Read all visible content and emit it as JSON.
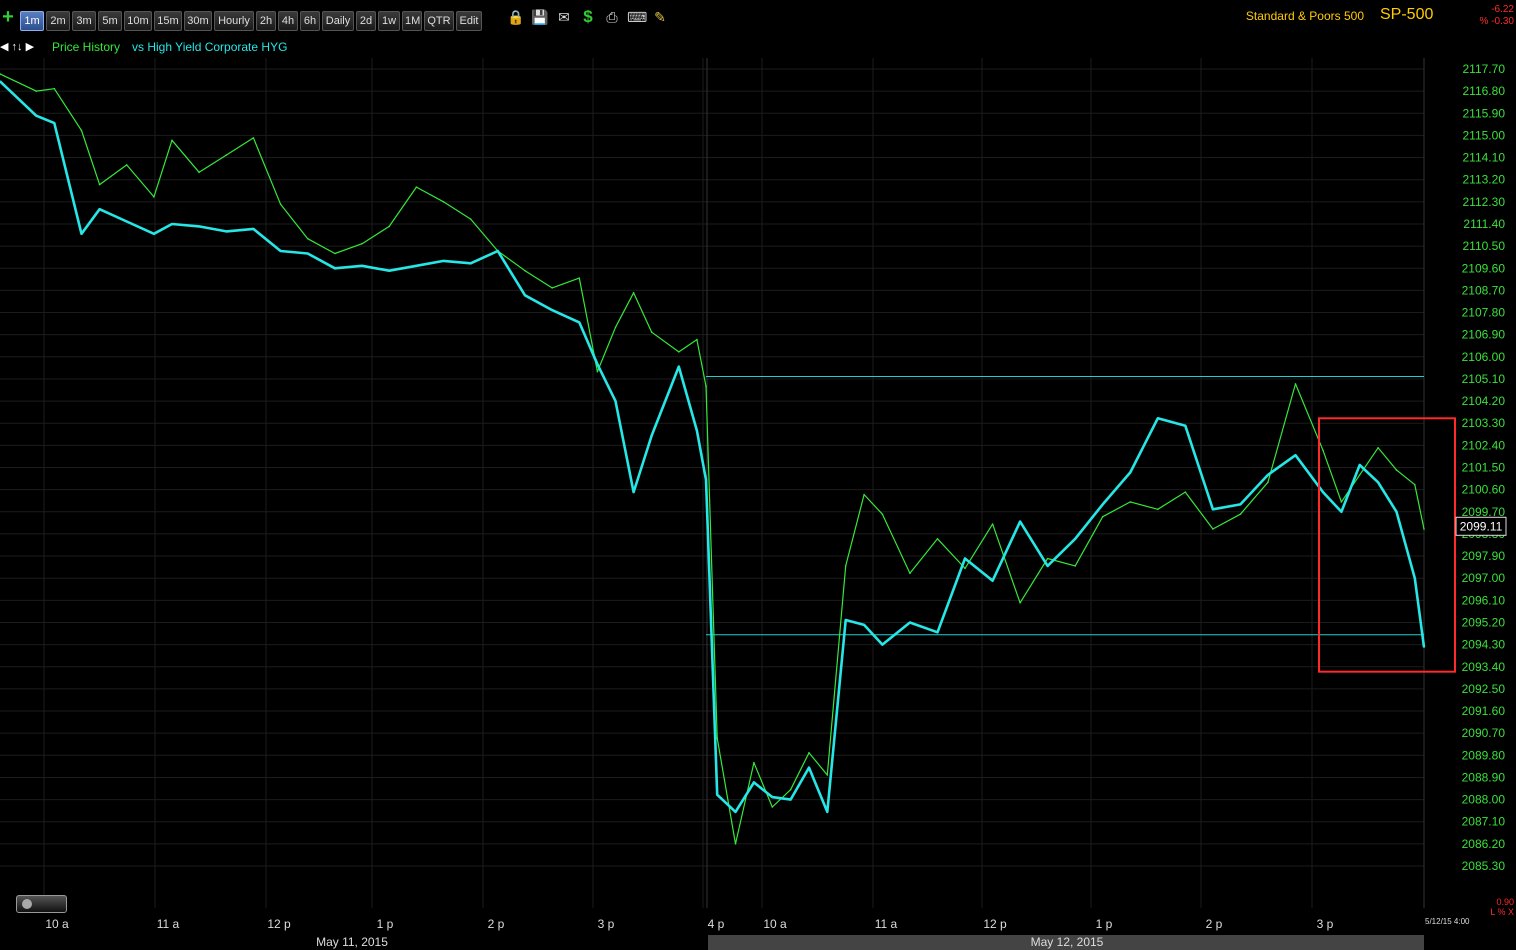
{
  "toolbar": {
    "intervals": [
      "1m",
      "2m",
      "3m",
      "5m",
      "10m",
      "15m",
      "30m",
      "Hourly",
      "2h",
      "4h",
      "6h",
      "Daily",
      "2d",
      "1w",
      "1M",
      "QTR",
      "Edit"
    ],
    "active_interval": "1m",
    "icons": [
      "lock-icon",
      "save-icon",
      "email-icon",
      "dollar-icon",
      "print-icon",
      "keyboard-icon",
      "pencil-icon"
    ]
  },
  "symbol": {
    "name": "Standard & Poors 500",
    "code": "SP-500",
    "change": "-6.22",
    "change_pct": "% -0.30"
  },
  "legend": {
    "nav": "◀ ↑↓ ▶",
    "series1": "Price History",
    "series2": "vs High Yield Corporate HYG"
  },
  "axis_controls": {
    "value": "0.90",
    "label": "L % X"
  },
  "date_stamp": "5/12/15 4:00",
  "colors": {
    "price": "#34e83a",
    "hyg": "#26e6e6",
    "axis_text": "#39e03a",
    "annotation": "#ff2a2a",
    "background": "#000000"
  },
  "chart_data": {
    "type": "line",
    "title": "",
    "ylim": [
      2084.8,
      2118.4
    ],
    "y_ticks": [
      "2117.70",
      "2116.80",
      "2115.90",
      "2115.00",
      "2114.10",
      "2113.20",
      "2112.30",
      "2111.40",
      "2110.50",
      "2109.60",
      "2108.70",
      "2107.80",
      "2106.90",
      "2106.00",
      "2105.10",
      "2104.20",
      "2103.30",
      "2102.40",
      "2101.50",
      "2100.60",
      "2099.70",
      "2098.80",
      "2097.90",
      "2097.00",
      "2096.10",
      "2095.20",
      "2094.30",
      "2093.40",
      "2092.50",
      "2091.60",
      "2090.70",
      "2089.80",
      "2088.90",
      "2088.00",
      "2087.10",
      "2086.20",
      "2085.30"
    ],
    "x_ticks": [
      "10 a",
      "11 a",
      "12 p",
      "1 p",
      "2 p",
      "3 p",
      "4 p",
      "10 a",
      "11 a",
      "12 p",
      "1 p",
      "2 p",
      "3 p"
    ],
    "x_sessions": [
      "May 11, 2015",
      "May 12, 2015"
    ],
    "last_price_label": "2099.11",
    "reference_lines": [
      2105.2,
      2094.7
    ],
    "highlight_box": {
      "x_range": [
        "3 p",
        "4 p"
      ],
      "y_range": [
        2093.2,
        2103.5
      ]
    },
    "series": [
      {
        "name": "Price History",
        "x": [
          "9:30",
          "9:50",
          "10:00",
          "10:15",
          "10:25",
          "10:40",
          "10:55",
          "11:05",
          "11:20",
          "11:35",
          "11:50",
          "12:05",
          "12:20",
          "12:35",
          "12:50",
          "13:05",
          "13:20",
          "13:35",
          "13:50",
          "14:05",
          "14:20",
          "14:35",
          "14:50",
          "15:00",
          "15:10",
          "15:20",
          "15:30",
          "15:45",
          "15:55",
          "16:00",
          "09:35",
          "09:45",
          "09:55",
          "10:05",
          "10:15",
          "10:25",
          "10:35",
          "10:45",
          "10:55",
          "11:05",
          "11:20",
          "11:35",
          "11:50",
          "12:05",
          "12:20",
          "12:35",
          "12:50",
          "13:05",
          "13:20",
          "13:35",
          "13:50",
          "14:05",
          "14:20",
          "14:35",
          "14:50",
          "15:05",
          "15:15",
          "15:25",
          "15:35",
          "15:45",
          "15:55",
          "16:00"
        ],
        "values": [
          2117.5,
          2116.8,
          2116.9,
          2115.2,
          2113.0,
          2113.8,
          2112.5,
          2114.8,
          2113.5,
          2114.2,
          2114.9,
          2112.2,
          2110.8,
          2110.2,
          2110.6,
          2111.3,
          2112.9,
          2112.3,
          2111.6,
          2110.3,
          2109.5,
          2108.8,
          2109.2,
          2105.4,
          2107.2,
          2108.6,
          2107.0,
          2106.2,
          2106.7,
          2104.8,
          2090.5,
          2086.2,
          2089.5,
          2087.7,
          2088.4,
          2089.9,
          2089.0,
          2097.5,
          2100.4,
          2099.6,
          2097.2,
          2098.6,
          2097.4,
          2099.2,
          2096.0,
          2097.8,
          2097.5,
          2099.5,
          2100.1,
          2099.8,
          2100.5,
          2099.0,
          2099.6,
          2100.9,
          2104.9,
          2102.2,
          2100.1,
          2101.2,
          2102.3,
          2101.4,
          2100.8,
          2099.0
        ]
      },
      {
        "name": "vs High Yield Corporate HYG",
        "x": [
          "9:30",
          "9:50",
          "10:00",
          "10:15",
          "10:25",
          "10:40",
          "10:55",
          "11:05",
          "11:20",
          "11:35",
          "11:50",
          "12:05",
          "12:20",
          "12:35",
          "12:50",
          "13:05",
          "13:20",
          "13:35",
          "13:50",
          "14:05",
          "14:20",
          "14:35",
          "14:50",
          "15:00",
          "15:10",
          "15:20",
          "15:30",
          "15:45",
          "15:55",
          "16:00",
          "09:35",
          "09:45",
          "09:55",
          "10:05",
          "10:15",
          "10:25",
          "10:35",
          "10:45",
          "10:55",
          "11:05",
          "11:20",
          "11:35",
          "11:50",
          "12:05",
          "12:20",
          "12:35",
          "12:50",
          "13:05",
          "13:20",
          "13:35",
          "13:50",
          "14:05",
          "14:20",
          "14:35",
          "14:50",
          "15:05",
          "15:15",
          "15:25",
          "15:35",
          "15:45",
          "15:55",
          "16:00"
        ],
        "values": [
          2117.2,
          2115.8,
          2115.5,
          2111.0,
          2112.0,
          2111.5,
          2111.0,
          2111.4,
          2111.3,
          2111.1,
          2111.2,
          2110.3,
          2110.2,
          2109.6,
          2109.7,
          2109.5,
          2109.7,
          2109.9,
          2109.8,
          2110.3,
          2108.5,
          2107.9,
          2107.4,
          2105.7,
          2104.2,
          2100.5,
          2102.8,
          2105.6,
          2103.0,
          2101.0,
          2088.2,
          2087.5,
          2088.7,
          2088.1,
          2088.0,
          2089.3,
          2087.5,
          2095.3,
          2095.1,
          2094.3,
          2095.2,
          2094.8,
          2097.8,
          2096.9,
          2099.3,
          2097.5,
          2098.6,
          2100.0,
          2101.3,
          2103.5,
          2103.2,
          2099.8,
          2100.0,
          2101.2,
          2102.0,
          2100.5,
          2099.7,
          2101.6,
          2100.9,
          2099.7,
          2097.0,
          2094.2
        ]
      }
    ]
  }
}
